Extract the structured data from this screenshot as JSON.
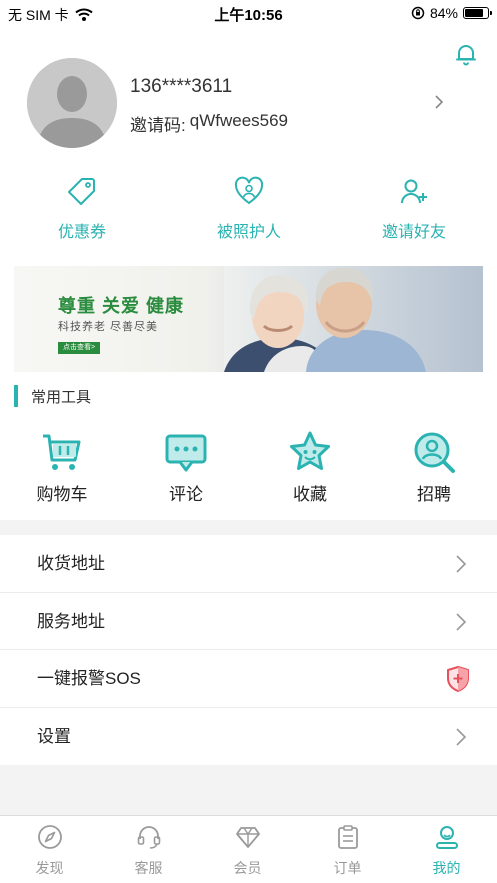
{
  "status_bar": {
    "carrier": "无 SIM 卡",
    "time": "上午10:56",
    "battery": "84%",
    "battery_level": 0.84
  },
  "profile": {
    "phone": "136****3611",
    "invite_label": "邀请码:",
    "invite_code": "qWfwees569"
  },
  "quick_actions": [
    {
      "label": "优惠券",
      "icon": "coupon-tag-icon"
    },
    {
      "label": "被照护人",
      "icon": "care-heart-icon"
    },
    {
      "label": "邀请好友",
      "icon": "add-friend-icon"
    }
  ],
  "banner": {
    "title": "尊重 关爱 健康",
    "subtitle": "科技养老 尽善尽美",
    "cta": "点击查看>"
  },
  "tools": {
    "title": "常用工具",
    "items": [
      {
        "label": "购物车",
        "icon": "cart-icon"
      },
      {
        "label": "评论",
        "icon": "comment-icon"
      },
      {
        "label": "收藏",
        "icon": "star-icon"
      },
      {
        "label": "招聘",
        "icon": "recruit-icon"
      }
    ]
  },
  "menu": [
    {
      "label": "收货地址",
      "icon": "chevron-right-icon"
    },
    {
      "label": "服务地址",
      "icon": "chevron-right-icon"
    },
    {
      "label": "一键报警SOS",
      "icon": "shield-plus-icon"
    },
    {
      "label": "设置",
      "icon": "chevron-right-icon"
    }
  ],
  "tabs": [
    {
      "label": "发现",
      "icon": "compass-icon"
    },
    {
      "label": "客服",
      "icon": "headset-icon"
    },
    {
      "label": "会员",
      "icon": "diamond-icon"
    },
    {
      "label": "订单",
      "icon": "clipboard-icon"
    },
    {
      "label": "我的",
      "icon": "user-icon",
      "active": true
    }
  ],
  "colors": {
    "accent": "#2bb3b1",
    "banner_green": "#2a8c3e",
    "sos_red": "#e8505b"
  }
}
